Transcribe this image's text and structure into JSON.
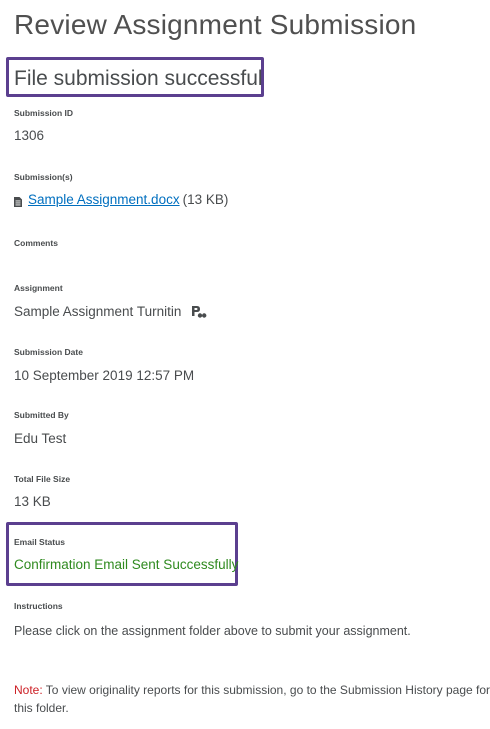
{
  "header": {
    "title": "Review Assignment Submission"
  },
  "banner": {
    "message": "File submission successful"
  },
  "fields": {
    "submission_id_label": "Submission ID",
    "submission_id_value": "1306",
    "submissions_label": "Submission(s)",
    "file_name": "Sample Assignment.docx",
    "file_size": "(13 KB)",
    "comments_label": "Comments",
    "assignment_label": "Assignment",
    "assignment_value": "Sample Assignment Turnitin",
    "submission_date_label": "Submission Date",
    "submission_date_value": "10 September 2019 12:57 PM",
    "submitted_by_label": "Submitted By",
    "submitted_by_value": "Edu Test",
    "total_file_size_label": "Total File Size",
    "total_file_size_value": "13 KB",
    "email_status_label": "Email Status",
    "email_status_value": "Confirmation Email Sent Successfully",
    "instructions_label": "Instructions",
    "instructions_value": "Please click on the assignment folder above to submit your assignment."
  },
  "note": {
    "label": "Note:",
    "text": " To view originality reports for this submission, go to the Submission History page for this folder."
  },
  "colors": {
    "highlight_border": "#5b3f8f",
    "link": "#006fbf",
    "success_green": "#2f8a1f",
    "note_red": "#cd2026"
  },
  "icons": {
    "file": "document-icon",
    "assignment": "turnitin-icon"
  }
}
